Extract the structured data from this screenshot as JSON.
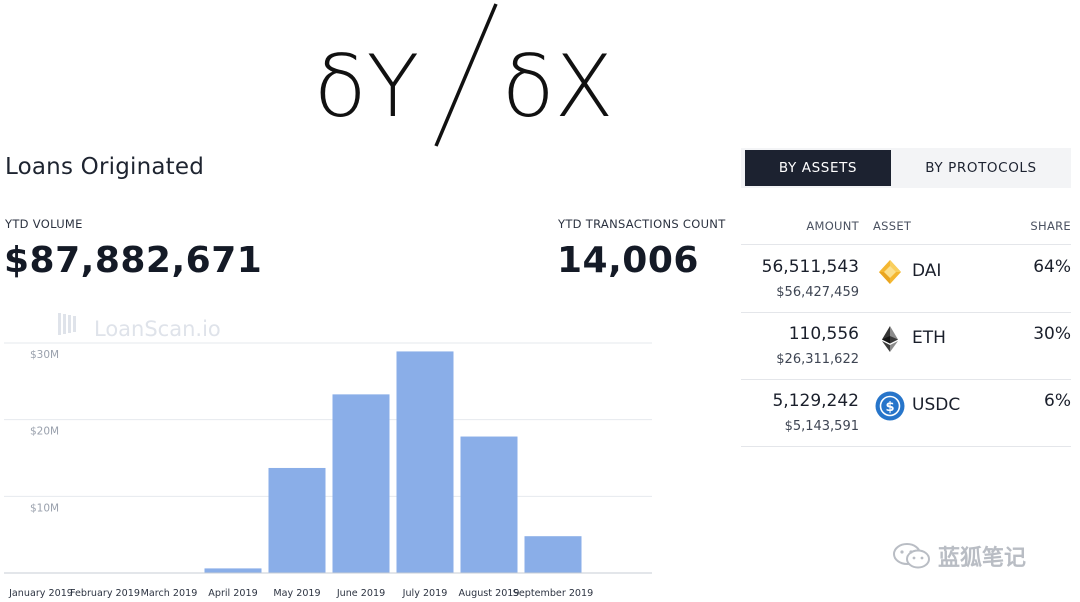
{
  "brand": {
    "left": "δY",
    "slash": "/",
    "right": "δX"
  },
  "loans": {
    "title": "Loans Originated",
    "ytd_volume_label": "YTD VOLUME",
    "ytd_volume_value": "$87,882,671",
    "ytd_tx_label": "YTD TRANSACTIONS COUNT",
    "ytd_tx_value": "14,006"
  },
  "chart_data": {
    "type": "bar",
    "watermark": "LoanScan.io",
    "categories": [
      "January 2019",
      "February 2019",
      "March 2019",
      "April 2019",
      "May 2019",
      "June 2019",
      "July 2019",
      "August 2019",
      "September 2019"
    ],
    "values": [
      0,
      0,
      0,
      0.6,
      13.7,
      23.3,
      28.9,
      17.8,
      4.8
    ],
    "ylim": [
      0,
      30.5
    ],
    "yticks": [
      10,
      20,
      30
    ],
    "ytick_labels": [
      "$10M",
      "$20M",
      "$30M"
    ],
    "bar_color": "#8aaee8",
    "grid": true
  },
  "tabs": {
    "by_assets": "BY ASSETS",
    "by_protocols": "BY PROTOCOLS"
  },
  "table": {
    "headers": {
      "amount": "AMOUNT",
      "asset": "ASSET",
      "share": "SHARE"
    },
    "rows": [
      {
        "amount": "56,511,543",
        "usd": "$56,427,459",
        "asset": "DAI",
        "icon": "dai-icon",
        "share": "64%"
      },
      {
        "amount": "110,556",
        "usd": "$26,311,622",
        "asset": "ETH",
        "icon": "eth-icon",
        "share": "30%"
      },
      {
        "amount": "5,129,242",
        "usd": "$5,143,591",
        "asset": "USDC",
        "icon": "usdc-icon",
        "share": "6%"
      }
    ]
  },
  "watermark": {
    "text": "蓝狐笔记",
    "icon": "wechat-icon"
  }
}
